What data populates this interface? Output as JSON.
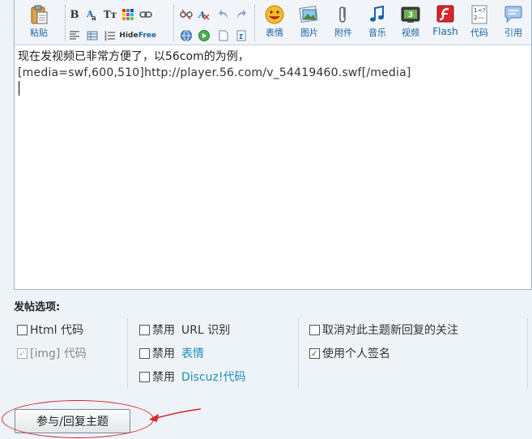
{
  "toolbar": {
    "paste_label": "粘贴",
    "emoticon_label": "表情",
    "image_label": "图片",
    "attach_label": "附件",
    "music_label": "音乐",
    "video_label": "视频",
    "flash_label": "Flash",
    "code_label": "代码",
    "quote_label": "引用",
    "hide_label": "Hide",
    "free_label": "Free"
  },
  "editor": {
    "line1": "现在发视频已非常方便了，以56com的为例，",
    "line2": "[media=swf,600,510]http://player.56.com/v_54419460.swf[/media]"
  },
  "options": {
    "title": "发帖选项:",
    "html_code": "Html 代码",
    "img_code": "[img] 代码",
    "disable_prefix": "禁用",
    "url_detect": "URL 识别",
    "emoticon": "表情",
    "discuz_code": "Discuz!代码",
    "unfollow": "取消对此主题新回复的关注",
    "use_signature": "使用个人签名"
  },
  "submit_label": "参与/回复主题",
  "colors": {
    "accent_link": "#1a8fb5",
    "annotation_red": "#d9252a"
  }
}
